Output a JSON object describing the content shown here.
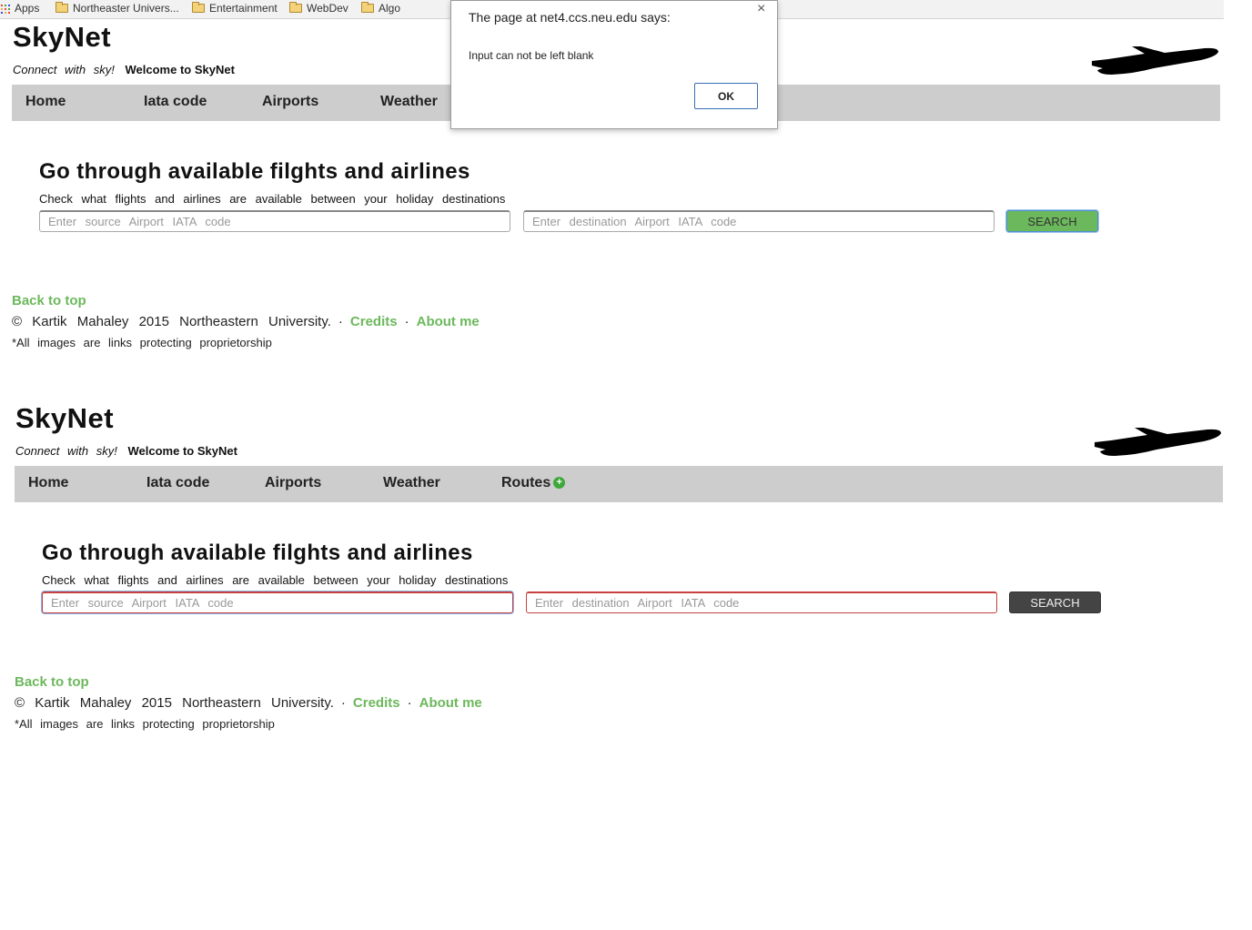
{
  "bookmarks": [
    {
      "label": "Apps",
      "icon": "apps-grid-icon"
    },
    {
      "label": "Northeaster Univers...",
      "icon": "folder-icon"
    },
    {
      "label": "Entertainment",
      "icon": "folder-icon"
    },
    {
      "label": "WebDev",
      "icon": "folder-icon"
    },
    {
      "label": "Algo",
      "icon": "folder-icon"
    }
  ],
  "site": {
    "logo": "SkyNet",
    "tagline": "Connect with sky!",
    "welcome": "Welcome to SkyNet",
    "nav": [
      "Home",
      "Iata code",
      "Airports",
      "Weather",
      "Routes"
    ],
    "heading": "Go through available filghts and airlines",
    "subtitle": "Check what flights and airlines are available between your holiday destinations",
    "source_placeholder": "Enter source Airport IATA code",
    "destination_placeholder": "Enter destination Airport IATA code",
    "search_label": "SEARCH",
    "back_to_top": "Back to top",
    "copyright": "© Kartik Mahaley 2015 Northeastern University.",
    "separator": "·",
    "credits": "Credits",
    "about": "About me",
    "footnote": "*All images are links protecting proprietorship"
  },
  "dialog": {
    "title": "The page at net4.ccs.neu.edu says:",
    "message": "Input can not be left blank",
    "ok": "OK",
    "close": "×"
  },
  "colors": {
    "link_green": "#6cb85c",
    "nav_bg": "#cdcdcd",
    "search_active": "#6cb85c",
    "search_dark": "#444444",
    "error_border": "#c84040"
  }
}
